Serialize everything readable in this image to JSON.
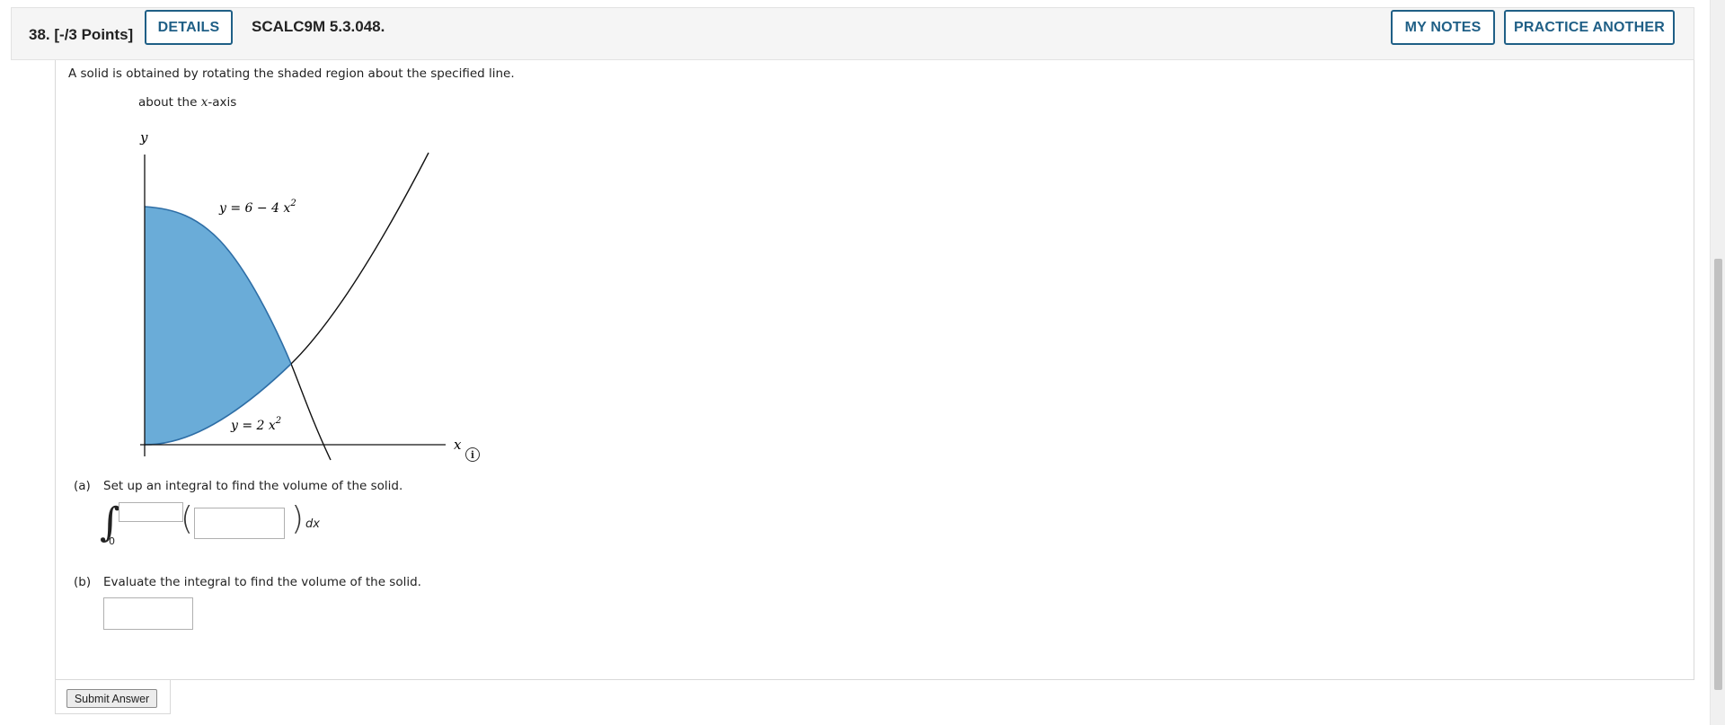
{
  "header": {
    "question_number": "38.",
    "points": "[-/3 Points]",
    "details_label": "DETAILS",
    "problem_code": "SCALC9M 5.3.048.",
    "my_notes_label": "MY NOTES",
    "practice_another_label": "PRACTICE ANOTHER"
  },
  "question": {
    "prompt": "A solid is obtained by rotating the shaded region about the specified line.",
    "rotation_prefix": "about the ",
    "rotation_var": "x",
    "rotation_suffix": "-axis"
  },
  "figure": {
    "y_axis_label": "y",
    "x_axis_label": "x",
    "curve_top_label_prefix": "y = 6 − 4 x",
    "curve_top_exponent": "2",
    "curve_bottom_label_prefix": "y = 2 x",
    "curve_bottom_exponent": "2",
    "shade_color": "#6aacd8",
    "info_icon_glyph": "i"
  },
  "part_a": {
    "label": "(a)",
    "text": "Set up an integral to find the volume of the solid.",
    "lower_limit": "0",
    "upper_value": "",
    "integrand_value": "",
    "dx_label": "dx"
  },
  "part_b": {
    "label": "(b)",
    "text": "Evaluate the integral to find the volume of the solid.",
    "answer_value": ""
  },
  "submit_label": "Submit Answer",
  "colors": {
    "accent": "#1f5f86",
    "header_bg": "#f5f5f5"
  }
}
